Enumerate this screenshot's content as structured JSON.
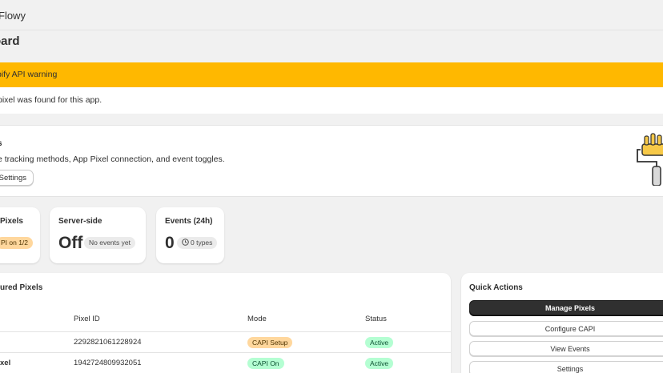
{
  "app": {
    "name": "Flowy"
  },
  "page": {
    "title": "oard"
  },
  "warning": {
    "title": "pify API warning",
    "message": "pixel was found for this app."
  },
  "settings": {
    "title": "s",
    "description": "e tracking methods, App Pixel connection, and event toggles.",
    "button_label": "Settings"
  },
  "stats": {
    "pixels": {
      "label": "Pixels",
      "pill": "PI on 1/2"
    },
    "server": {
      "label": "Server-side",
      "value": "Off",
      "pill": "No events yet"
    },
    "events": {
      "label": "Events (24h)",
      "value": "0",
      "pill": "0 types"
    }
  },
  "pixels_table": {
    "title": "ured Pixels",
    "headers": [
      "Pixel ID",
      "Mode",
      "Status"
    ],
    "rows": [
      {
        "name": "",
        "id": "2292821061228924",
        "mode": "CAPI Setup",
        "status": "Active"
      },
      {
        "name": "xel",
        "id": "1942724809932051",
        "mode": "CAPI On",
        "status": "Active"
      }
    ]
  },
  "quick_actions": {
    "title": "Quick Actions",
    "buttons": [
      "Manage Pixels",
      "Configure CAPI",
      "View Events",
      "Settings"
    ]
  },
  "colors": {
    "warning": "#ffb800",
    "primary_button": "#303030",
    "badge_green": "#b4fed2",
    "badge_orange": "#ffd79d"
  },
  "icons": {
    "clock": "clock-icon",
    "illustration": "paint-roller-icon"
  }
}
